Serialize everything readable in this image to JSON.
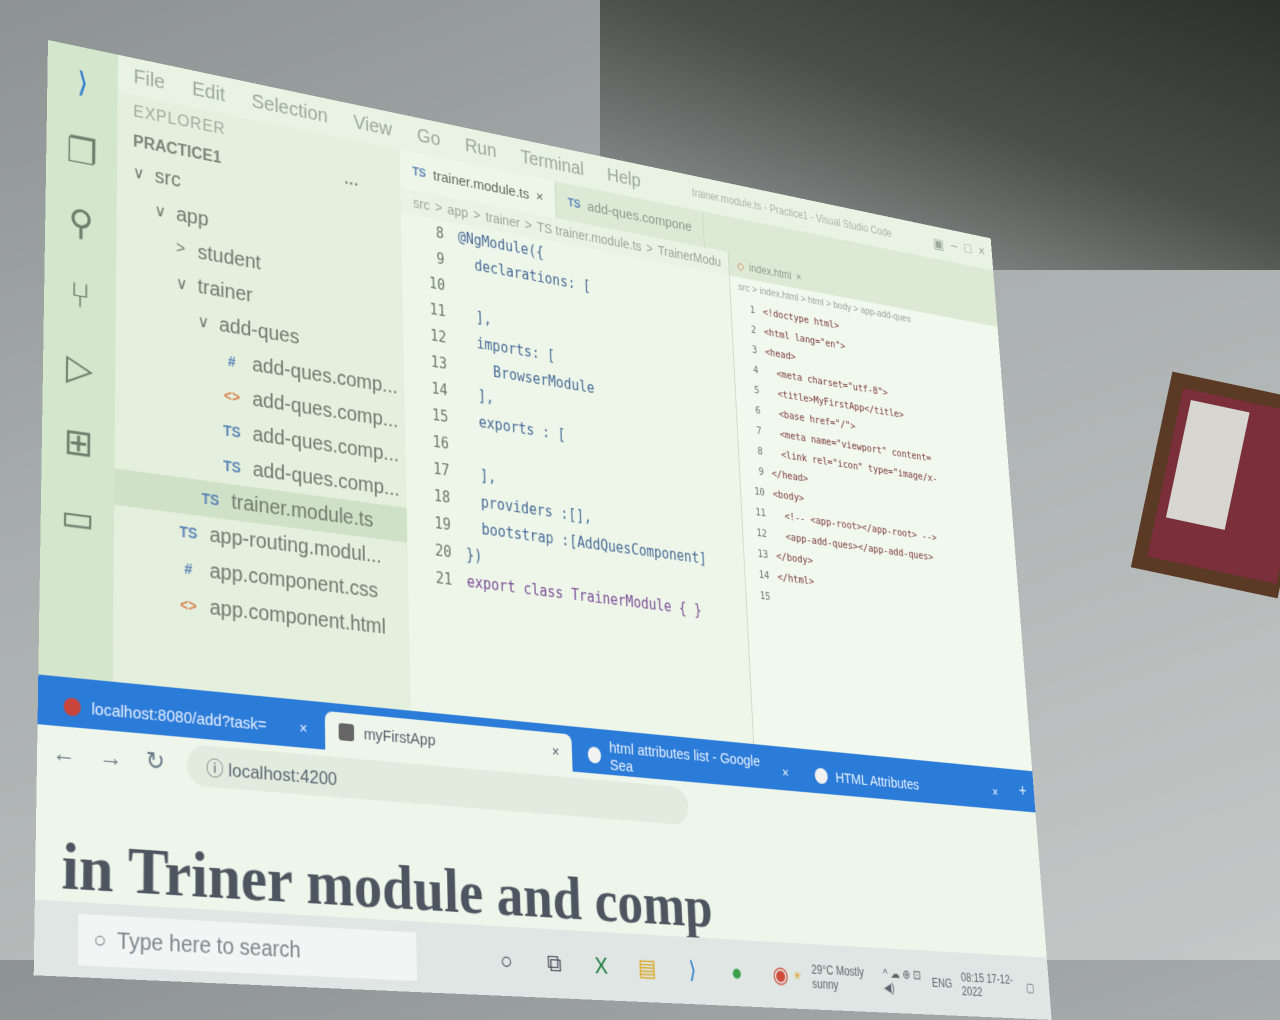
{
  "vscode": {
    "menu": [
      "File",
      "Edit",
      "Selection",
      "View",
      "Go",
      "Run",
      "Terminal",
      "Help"
    ],
    "window_title": "trainer.module.ts - Practice1 - Visual Studio Code",
    "explorer_title": "EXPLORER",
    "project_name": "PRACTICE1",
    "project_more": "···",
    "tree": [
      {
        "label": "src",
        "indent": 0,
        "chev": "∨",
        "icon": ""
      },
      {
        "label": "app",
        "indent": 1,
        "chev": "∨",
        "icon": ""
      },
      {
        "label": "student",
        "indent": 2,
        "chev": ">",
        "icon": ""
      },
      {
        "label": "trainer",
        "indent": 2,
        "chev": "∨",
        "icon": ""
      },
      {
        "label": "add-ques",
        "indent": 3,
        "chev": "∨",
        "icon": ""
      },
      {
        "label": "add-ques.comp...",
        "indent": 4,
        "chev": "",
        "icon": "#"
      },
      {
        "label": "add-ques.comp...",
        "indent": 4,
        "chev": "",
        "icon": "<>"
      },
      {
        "label": "add-ques.comp...",
        "indent": 4,
        "chev": "",
        "icon": "TS"
      },
      {
        "label": "add-ques.comp...",
        "indent": 4,
        "chev": "",
        "icon": "TS"
      },
      {
        "label": "trainer.module.ts",
        "indent": 3,
        "chev": "",
        "icon": "TS",
        "selected": true
      },
      {
        "label": "app-routing.modul...",
        "indent": 2,
        "chev": "",
        "icon": "TS"
      },
      {
        "label": "app.component.css",
        "indent": 2,
        "chev": "",
        "icon": "#"
      },
      {
        "label": "app.component.html",
        "indent": 2,
        "chev": "",
        "icon": "<>"
      }
    ],
    "tabs": [
      {
        "label": "trainer.module.ts",
        "close": "×",
        "active": true
      },
      {
        "label": "add-ques.compone",
        "close": "",
        "active": false
      }
    ],
    "breadcrumb": [
      "src",
      ">",
      "app",
      ">",
      "trainer",
      ">",
      "TS trainer.module.ts",
      ">",
      "TrainerModu"
    ],
    "code_lines": [
      {
        "n": "8",
        "t": "@NgModule({",
        "kw": false
      },
      {
        "n": "9",
        "t": "  declarations: [",
        "kw": false
      },
      {
        "n": "10",
        "t": "",
        "kw": false
      },
      {
        "n": "11",
        "t": "  ],",
        "kw": false
      },
      {
        "n": "12",
        "t": "  imports: [",
        "kw": false
      },
      {
        "n": "13",
        "t": "    BrowserModule",
        "kw": false
      },
      {
        "n": "14",
        "t": "  ],",
        "kw": false
      },
      {
        "n": "15",
        "t": "  exports : [",
        "kw": false
      },
      {
        "n": "16",
        "t": "",
        "kw": false
      },
      {
        "n": "17",
        "t": "  ],",
        "kw": false
      },
      {
        "n": "18",
        "t": "  providers :[],",
        "kw": false
      },
      {
        "n": "19",
        "t": "  bootstrap :[AddQuesComponent]",
        "kw": false
      },
      {
        "n": "20",
        "t": "})",
        "kw": false
      },
      {
        "n": "21",
        "t": "export class TrainerModule { }",
        "kw": true
      }
    ],
    "split_tab": "index.html",
    "split_tab_close": "×",
    "split_breadcrumb": "src > index.html > html > body > app-add-ques",
    "html_lines": [
      {
        "n": "1",
        "t": "<!doctype html>"
      },
      {
        "n": "2",
        "t": "<html lang=\"en\">"
      },
      {
        "n": "3",
        "t": "<head>"
      },
      {
        "n": "4",
        "t": "  <meta charset=\"utf-8\">"
      },
      {
        "n": "5",
        "t": "  <title>MyFirstApp</title>"
      },
      {
        "n": "6",
        "t": "  <base href=\"/\">"
      },
      {
        "n": "7",
        "t": "  <meta name=\"viewport\" content="
      },
      {
        "n": "8",
        "t": "  <link rel=\"icon\" type=\"image/x-"
      },
      {
        "n": "9",
        "t": "</head>"
      },
      {
        "n": "10",
        "t": "<body>"
      },
      {
        "n": "11",
        "t": "  <!-- <app-root></app-root> -->"
      },
      {
        "n": "12",
        "t": "  <app-add-ques></app-add-ques>"
      },
      {
        "n": "13",
        "t": "</body>"
      },
      {
        "n": "14",
        "t": "</html>"
      },
      {
        "n": "15",
        "t": ""
      }
    ]
  },
  "browser": {
    "tabs": [
      {
        "label": "localhost:8080/add?task=",
        "close": "×",
        "active": false,
        "fav": "red"
      },
      {
        "label": "myFirstApp",
        "close": "×",
        "active": true,
        "fav": "ng"
      },
      {
        "label": "html attributes list - Google Sea",
        "close": "×",
        "active": false,
        "fav": "g"
      },
      {
        "label": "HTML Attributes",
        "close": "×",
        "active": false,
        "fav": "g"
      }
    ],
    "new_tab": "+",
    "address": "localhost:4200",
    "page_heading": "in Triner module and comp"
  },
  "taskbar": {
    "search_placeholder": "Type here to search",
    "weather": "29°C Mostly sunny",
    "lang": "ENG",
    "time": "08:15",
    "date": "17-12-2022"
  },
  "colors": {
    "browser_tab_bar": "#2b7bd9",
    "screen_bg": "#e9f3e4"
  }
}
